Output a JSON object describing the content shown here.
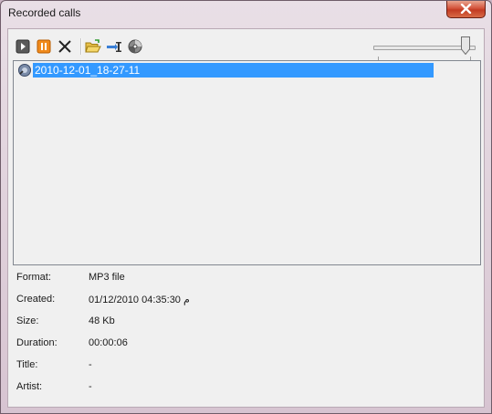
{
  "window": {
    "title": "Recorded calls"
  },
  "toolbar": {
    "buttons": [
      {
        "name": "play",
        "icon": "play-icon"
      },
      {
        "name": "pause",
        "icon": "pause-icon"
      },
      {
        "name": "delete",
        "icon": "delete-icon"
      },
      {
        "name": "open-folder",
        "icon": "open-folder-icon"
      },
      {
        "name": "export",
        "icon": "export-icon"
      },
      {
        "name": "burn",
        "icon": "disc-icon"
      }
    ],
    "volume": 0.92
  },
  "list": {
    "items": [
      {
        "label": "2010-12-01_18-27-11",
        "selected": true,
        "icon": "recording-icon"
      }
    ]
  },
  "details": {
    "rows": [
      {
        "label": "Format:",
        "value": "MP3 file"
      },
      {
        "label": "Created:",
        "value": "01/12/2010 04:35:30 م"
      },
      {
        "label": "Size:",
        "value": "48 Kb"
      },
      {
        "label": "Duration:",
        "value": "00:00:06"
      },
      {
        "label": "Title:",
        "value": "-"
      },
      {
        "label": "Artist:",
        "value": "-"
      }
    ]
  },
  "colors": {
    "selection": "#3399ff",
    "close": "#c23b22"
  }
}
